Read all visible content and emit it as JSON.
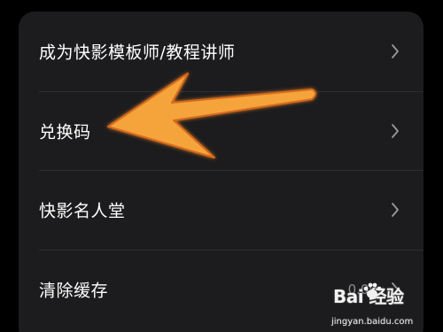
{
  "menu": {
    "items": [
      {
        "label": "成为快影模板师/教程讲师",
        "value": ""
      },
      {
        "label": "兑换码",
        "value": ""
      },
      {
        "label": "快影名人堂",
        "value": ""
      },
      {
        "label": "清除缓存",
        "value": "0.09"
      }
    ]
  },
  "watermark": {
    "brand": "Bai 经验",
    "url": "jingyan.baidu.com"
  },
  "colors": {
    "card_background": "#1c1c1e",
    "arrow": "#f5a43a",
    "text": "#ffffff",
    "secondary_text": "#8e8e93"
  },
  "icons": {
    "chevron": "chevron-right-icon",
    "annotation": "annotation-arrow",
    "watermark_logo": "baidu-paw-icon"
  }
}
